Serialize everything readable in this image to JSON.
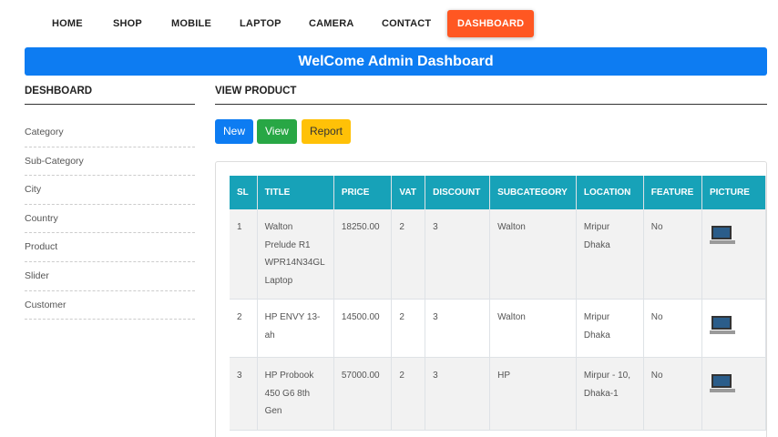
{
  "nav": {
    "items": [
      {
        "label": "HOME"
      },
      {
        "label": "SHOP"
      },
      {
        "label": "MOBILE"
      },
      {
        "label": "LAPTOP"
      },
      {
        "label": "CAMERA"
      },
      {
        "label": "CONTACT"
      },
      {
        "label": "DASHBOARD",
        "active": true
      }
    ]
  },
  "banner": {
    "title": "WelCome Admin Dashboard"
  },
  "sidebar": {
    "title": "DESHBOARD",
    "items": [
      {
        "label": "Category"
      },
      {
        "label": "Sub-Category"
      },
      {
        "label": "City"
      },
      {
        "label": "Country"
      },
      {
        "label": "Product"
      },
      {
        "label": "Slider"
      },
      {
        "label": "Customer"
      }
    ]
  },
  "main": {
    "title": "VIEW PRODUCT",
    "buttons": {
      "new": "New",
      "view": "View",
      "report": "Report"
    },
    "table": {
      "headers": [
        "SL",
        "TITLE",
        "PRICE",
        "VAT",
        "DISCOUNT",
        "SUBCATEGORY",
        "LOCATION",
        "FEATURE",
        "PICTURE"
      ],
      "rows": [
        {
          "sl": "1",
          "title": "Walton Prelude R1 WPR14N34GL Laptop",
          "price": "18250.00",
          "vat": "2",
          "discount": "3",
          "subcategory": "Walton",
          "location": "Mripur Dhaka",
          "feature": "No",
          "picture": "laptop-image"
        },
        {
          "sl": "2",
          "title": "HP ENVY 13-ah",
          "price": "14500.00",
          "vat": "2",
          "discount": "3",
          "subcategory": "Walton",
          "location": "Mripur Dhaka",
          "feature": "No",
          "picture": "laptop-image"
        },
        {
          "sl": "3",
          "title": "HP Probook 450 G6 8th Gen",
          "price": "57000.00",
          "vat": "2",
          "discount": "3",
          "subcategory": "HP",
          "location": "Mirpur - 10, Dhaka-1",
          "feature": "No",
          "picture": "laptop-image"
        }
      ]
    }
  },
  "colors": {
    "accent": "#0d7cf2",
    "active_nav": "#ff5722",
    "table_header": "#17a2b8",
    "view_button": "#28a745",
    "report_button": "#ffc107"
  }
}
